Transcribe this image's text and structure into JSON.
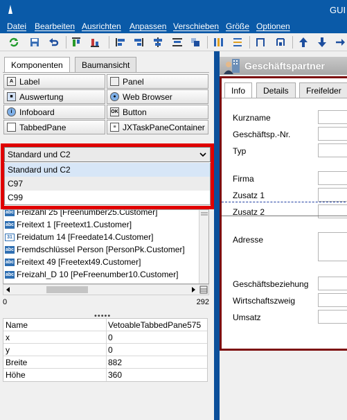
{
  "window": {
    "title": "GUI"
  },
  "menu": [
    "Datei",
    "Bearbeiten",
    "Ausrichten",
    "Anpassen",
    "Verschieben",
    "Größe",
    "Optionen"
  ],
  "toolbar": {
    "icons": [
      "refresh-icon",
      "save-icon",
      "undo-icon",
      "align-top-icon",
      "align-bottom-icon",
      "align-left-icon",
      "align-right-icon",
      "align-center-icon",
      "distribute-icon",
      "bring-front-icon",
      "send-back-icon",
      "size-icon",
      "move-up-icon",
      "lock-icon",
      "tab-order-icon"
    ]
  },
  "palette": {
    "tabs": [
      "Komponenten",
      "Baumansicht"
    ],
    "active_tab": 0,
    "items": [
      {
        "label": "Label",
        "icon": "label-icon"
      },
      {
        "label": "Panel",
        "icon": "panel-icon"
      },
      {
        "label": "Auswertung",
        "icon": "chart-icon"
      },
      {
        "label": "Web Browser",
        "icon": "globe-icon"
      },
      {
        "label": "Infoboard",
        "icon": "info-icon"
      },
      {
        "label": "Button",
        "icon": "button-icon"
      },
      {
        "label": "TabbedPane",
        "icon": "tabbedpane-icon"
      },
      {
        "label": "JXTaskPaneContainer",
        "icon": "taskpane-icon"
      }
    ]
  },
  "combo": {
    "selected": "Standard und C2",
    "options": [
      "Standard und C2",
      "C97",
      "C99"
    ]
  },
  "fields": [
    {
      "label": "Freizahl 25 [Freenumber25.Customer]",
      "icon": "abc-icon"
    },
    {
      "label": "Freitext 1 [Freetext1.Customer]",
      "icon": "abc-icon"
    },
    {
      "label": "Freidatum 14 [Freedate14.Customer]",
      "icon": "calendar-icon"
    },
    {
      "label": "Fremdschlüssel Person [PersonPk.Customer]",
      "icon": "abc-icon"
    },
    {
      "label": "Freitext 49 [Freetext49.Customer]",
      "icon": "abc-icon"
    },
    {
      "label": "Freizahl_D 10 [PeFreenumber10.Customer]",
      "icon": "abc-icon"
    }
  ],
  "scroll": {
    "min": "0",
    "max": "292"
  },
  "properties": [
    {
      "key": "Name",
      "value": "VetoableTabbedPane575"
    },
    {
      "key": "x",
      "value": "0"
    },
    {
      "key": "y",
      "value": "0"
    },
    {
      "key": "Breite",
      "value": "882"
    },
    {
      "key": "Höhe",
      "value": "360"
    }
  ],
  "form": {
    "title": "Geschäftspartner",
    "tabs": [
      "Info",
      "Details",
      "Freifelder"
    ],
    "active_tab": 0,
    "labels": [
      "Kurzname",
      "Geschäftsp.-Nr.",
      "Typ",
      "Firma",
      "Zusatz 1",
      "Zusatz 2",
      "Adresse",
      "Geschäftsbeziehung",
      "Wirtschaftszweig",
      "Umsatz"
    ]
  },
  "colors": {
    "accent": "#0a5aa8",
    "highlight_border": "#e00000",
    "form_border": "#7c0a0a"
  }
}
